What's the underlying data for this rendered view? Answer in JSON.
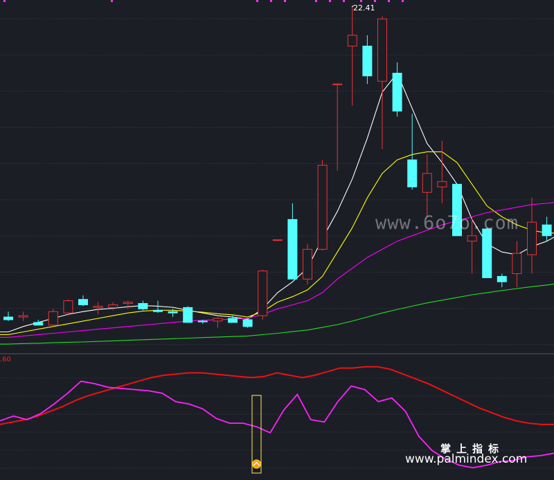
{
  "chart_data": [
    {
      "type": "candlestick",
      "peak_label": "22.41",
      "y_range": [
        9.8,
        22.6
      ],
      "candles": [
        {
          "o": 10.9,
          "h": 11.1,
          "l": 10.75,
          "c": 10.8
        },
        {
          "o": 10.9,
          "h": 11.1,
          "l": 10.75,
          "c": 10.95
        },
        {
          "o": 10.7,
          "h": 10.8,
          "l": 10.6,
          "c": 10.6
        },
        {
          "o": 10.6,
          "h": 11.2,
          "l": 10.55,
          "c": 11.1
        },
        {
          "o": 11.05,
          "h": 11.55,
          "l": 10.95,
          "c": 11.5
        },
        {
          "o": 11.55,
          "h": 11.7,
          "l": 11.3,
          "c": 11.35
        },
        {
          "o": 11.25,
          "h": 11.45,
          "l": 11.0,
          "c": 11.3
        },
        {
          "o": 11.25,
          "h": 11.45,
          "l": 11.15,
          "c": 11.35
        },
        {
          "o": 11.4,
          "h": 11.5,
          "l": 11.2,
          "c": 11.45
        },
        {
          "o": 11.4,
          "h": 11.5,
          "l": 11.15,
          "c": 11.2
        },
        {
          "o": 11.15,
          "h": 11.5,
          "l": 11.05,
          "c": 11.1
        },
        {
          "o": 11.1,
          "h": 11.2,
          "l": 10.9,
          "c": 11.05
        },
        {
          "o": 11.25,
          "h": 11.3,
          "l": 10.7,
          "c": 10.7
        },
        {
          "o": 10.75,
          "h": 10.8,
          "l": 10.65,
          "c": 10.72
        },
        {
          "o": 10.75,
          "h": 10.9,
          "l": 10.5,
          "c": 10.85
        },
        {
          "o": 10.85,
          "h": 10.95,
          "l": 10.7,
          "c": 10.7
        },
        {
          "o": 10.8,
          "h": 10.85,
          "l": 10.5,
          "c": 10.55
        },
        {
          "o": 10.95,
          "h": 12.65,
          "l": 10.8,
          "c": 12.6
        },
        {
          "o": 13.75,
          "h": 13.75,
          "l": 13.7,
          "c": 13.75
        },
        {
          "o": 14.5,
          "h": 15.1,
          "l": 12.3,
          "c": 12.3
        },
        {
          "o": 12.3,
          "h": 13.6,
          "l": 12.1,
          "c": 13.4
        },
        {
          "o": 13.4,
          "h": 16.7,
          "l": 13.35,
          "c": 16.5
        },
        {
          "o": 19.5,
          "h": 19.5,
          "l": 16.3,
          "c": 19.5
        },
        {
          "o": 20.9,
          "h": 22.41,
          "l": 18.7,
          "c": 21.3
        },
        {
          "o": 20.9,
          "h": 21.3,
          "l": 19.5,
          "c": 19.8
        },
        {
          "o": 19.6,
          "h": 22.0,
          "l": 17.1,
          "c": 21.9
        },
        {
          "o": 19.9,
          "h": 20.3,
          "l": 18.3,
          "c": 18.5
        },
        {
          "o": 16.7,
          "h": 18.4,
          "l": 15.6,
          "c": 15.7
        },
        {
          "o": 15.5,
          "h": 16.9,
          "l": 14.6,
          "c": 16.2
        },
        {
          "o": 15.7,
          "h": 17.4,
          "l": 15.1,
          "c": 15.9
        },
        {
          "o": 15.8,
          "h": 15.8,
          "l": 13.9,
          "c": 13.9
        },
        {
          "o": 13.7,
          "h": 14.6,
          "l": 12.5,
          "c": 13.9
        },
        {
          "o": 14.15,
          "h": 14.2,
          "l": 12.35,
          "c": 12.35
        },
        {
          "o": 12.4,
          "h": 12.5,
          "l": 12.0,
          "c": 12.2
        },
        {
          "o": 12.5,
          "h": 13.7,
          "l": 12.0,
          "c": 13.25
        },
        {
          "o": 13.2,
          "h": 15.3,
          "l": 12.5,
          "c": 14.4
        },
        {
          "o": 14.3,
          "h": 14.6,
          "l": 13.7,
          "c": 13.9
        },
        {
          "o": 13.95,
          "h": 15.0,
          "l": 13.4,
          "c": 14.9
        }
      ],
      "ma_lines": [
        {
          "name": "MA5",
          "color": "#ffffff",
          "values": [
            10.35,
            10.55,
            10.7,
            10.85,
            11.0,
            11.1,
            11.18,
            11.22,
            11.28,
            11.32,
            11.3,
            11.26,
            11.15,
            11.05,
            10.95,
            10.9,
            10.82,
            11.2,
            11.8,
            12.2,
            12.7,
            13.8,
            14.8,
            16.0,
            17.5,
            19.2,
            19.9,
            18.6,
            17.3,
            16.6,
            15.8,
            14.5,
            13.6,
            13.3,
            13.2,
            13.5,
            13.7,
            14.0
          ]
        },
        {
          "name": "MA10",
          "color": "#ffff00",
          "values": [
            10.25,
            10.35,
            10.45,
            10.55,
            10.65,
            10.75,
            10.85,
            10.95,
            11.05,
            11.12,
            11.15,
            11.15,
            11.12,
            11.08,
            11.02,
            10.98,
            10.9,
            11.1,
            11.45,
            11.65,
            11.9,
            12.4,
            13.3,
            14.2,
            15.3,
            16.2,
            16.7,
            16.9,
            17.0,
            17.0,
            16.6,
            15.8,
            15.0,
            14.6,
            14.3,
            14.1,
            14.0,
            14.0
          ]
        },
        {
          "name": "MA20",
          "color": "#ff00ff",
          "values": [
            10.15,
            10.2,
            10.25,
            10.3,
            10.35,
            10.4,
            10.45,
            10.5,
            10.55,
            10.6,
            10.65,
            10.7,
            10.75,
            10.78,
            10.8,
            10.82,
            10.85,
            11.0,
            11.2,
            11.35,
            11.5,
            11.8,
            12.3,
            12.7,
            13.1,
            13.4,
            13.7,
            13.9,
            14.1,
            14.3,
            14.45,
            14.6,
            14.75,
            14.85,
            14.95,
            15.05,
            15.1,
            15.15
          ]
        },
        {
          "name": "MA60",
          "color": "#22e022",
          "values": [
            9.9,
            9.92,
            9.93,
            9.95,
            9.97,
            9.98,
            10.0,
            10.02,
            10.04,
            10.06,
            10.08,
            10.1,
            10.12,
            10.14,
            10.16,
            10.18,
            10.2,
            10.25,
            10.3,
            10.36,
            10.42,
            10.52,
            10.62,
            10.75,
            10.9,
            11.05,
            11.18,
            11.3,
            11.42,
            11.52,
            11.62,
            11.72,
            11.8,
            11.88,
            11.95,
            12.02,
            12.08,
            12.15
          ]
        }
      ]
    },
    {
      "type": "line",
      "axis_label": ".60",
      "y_range": [
        0,
        100
      ],
      "series": [
        {
          "color": "#ee1111",
          "values": [
            44,
            46,
            48,
            51,
            55,
            59,
            64,
            68,
            71,
            74,
            77,
            80,
            83,
            85,
            86,
            87,
            87,
            86,
            85,
            84,
            83,
            84,
            87,
            85,
            83,
            85,
            88,
            91,
            91,
            92,
            92,
            90,
            86,
            82,
            78,
            73,
            68,
            63,
            58,
            54,
            50,
            47,
            45,
            44,
            44
          ]
        },
        {
          "color": "#ff22ff",
          "values": [
            47,
            51,
            48,
            53,
            61,
            70,
            80,
            78,
            75,
            74,
            73,
            72,
            70,
            63,
            61,
            57,
            49,
            45,
            45,
            42,
            37,
            56,
            69,
            48,
            46,
            63,
            76,
            73,
            63,
            66,
            55,
            34,
            22,
            15,
            10,
            8,
            10,
            13,
            14,
            17,
            18,
            20
          ]
        }
      ],
      "signal_label": "△"
    }
  ],
  "watermarks": {
    "top": "www.6o7o.com",
    "bottom_cn": "掌上指标",
    "bottom_url": "www.palmindex.com"
  }
}
